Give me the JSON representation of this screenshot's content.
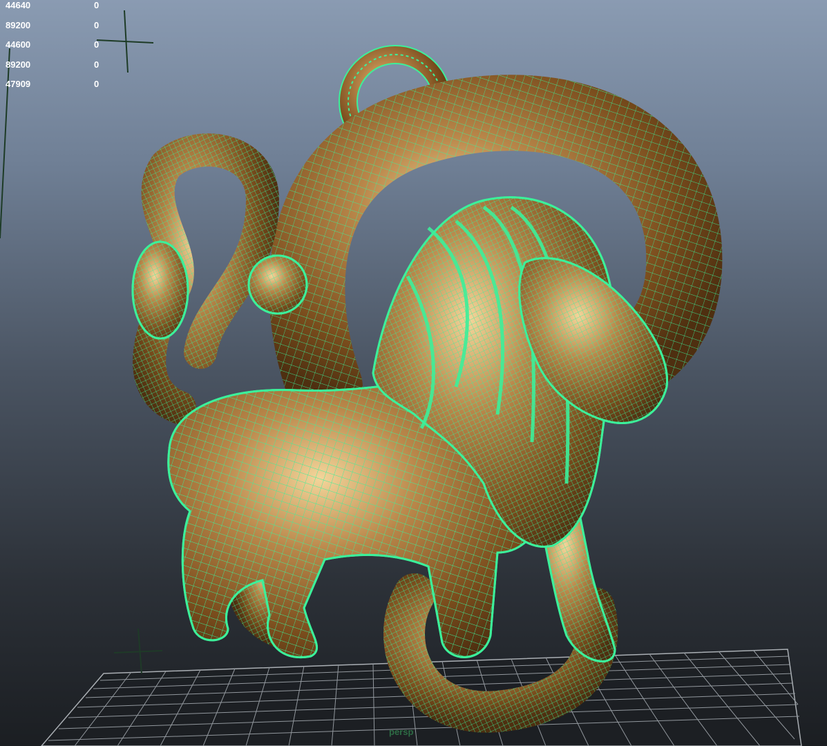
{
  "viewport": {
    "name": "3D perspective viewport",
    "camera_label": "persp",
    "wireframe_color": "#3cf09a",
    "mesh_color": "#8a5a26",
    "grid_color": "#9aa1a8"
  },
  "hud": {
    "rows": [
      {
        "value": "44640",
        "second": "0"
      },
      {
        "value": "89200",
        "second": "0"
      },
      {
        "value": "44600",
        "second": "0"
      },
      {
        "value": "89200",
        "second": "0"
      },
      {
        "value": "47909",
        "second": "0"
      }
    ]
  },
  "model": {
    "icon": "lion-pendant-model"
  }
}
